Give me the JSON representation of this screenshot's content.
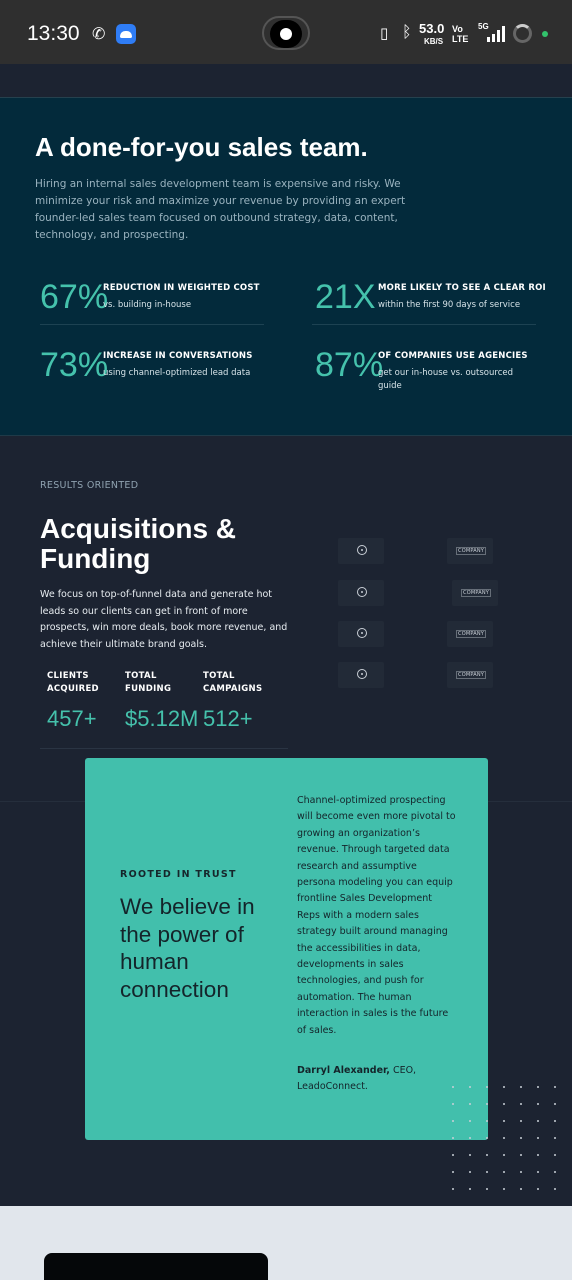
{
  "status_bar": {
    "time": "13:30",
    "phone_icon": "phone-icon",
    "app_icon": "cloud-app-icon",
    "speed_value": "53.0",
    "speed_unit": "KB/S",
    "volte_top": "Vo",
    "volte_bottom": "LTE",
    "network": "5G"
  },
  "hero": {
    "title": "A done-for-you sales team.",
    "description": "Hiring an internal sales development team is expensive and risky. We minimize your risk and maximize your revenue by providing an expert founder-led sales team focused on outbound strategy, data, content, technology, and prospecting.",
    "stats": [
      {
        "number": "67%",
        "label": "REDUCTION IN WEIGHTED COST",
        "sub": "vs. building in-house"
      },
      {
        "number": "21X",
        "label": "MORE LIKELY TO SEE A CLEAR ROI",
        "sub": "within the first 90 days of service"
      },
      {
        "number": "73%",
        "label": "INCREASE IN CONVERSATIONS",
        "sub": "using channel-optimized lead data"
      },
      {
        "number": "87%",
        "label": "OF COMPANIES USE AGENCIES",
        "sub": "get our in-house vs. outsourced guide"
      }
    ]
  },
  "results": {
    "eyebrow": "RESULTS ORIENTED",
    "title": "Acquisitions & Funding",
    "description": "We focus on top-of-funnel data and generate hot leads so our clients can get in front of more prospects, win more deals, book more revenue, and achieve their ultimate brand goals.",
    "kpis": [
      {
        "head1": "CLIENTS",
        "head2": "ACQUIRED",
        "value": "457+"
      },
      {
        "head1": "TOTAL",
        "head2": "FUNDING",
        "value": "$5.12M"
      },
      {
        "head1": "TOTAL",
        "head2": "CAMPAIGNS",
        "value": "512+"
      }
    ],
    "logo_word": "COMPANY"
  },
  "quote": {
    "eyebrow": "ROOTED IN TRUST",
    "title": "We believe in the power of human connection",
    "text": "Channel-optimized prospecting will become even more pivotal to growing an organization’s revenue. Through targeted data research and assumptive persona modeling you can equip frontline Sales Development Reps with a modern sales strategy built around managing the accessibilities in data, developments in sales technologies, and push for automation. The human interaction in sales is the future of sales.",
    "author_name": "Darryl Alexander,",
    "author_role": " CEO, LeadoConnect."
  },
  "colors": {
    "accent": "#45c2ac",
    "hero_bg": "#032a3b",
    "page_bg": "#1c2331",
    "card_bg": "#42bfac"
  }
}
